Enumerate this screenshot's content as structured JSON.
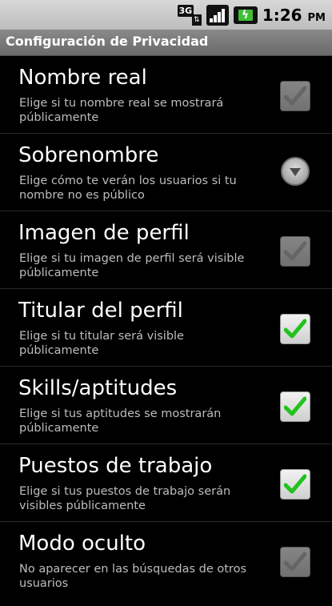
{
  "status_bar": {
    "network": "3G",
    "time": "1:26",
    "ampm": "PM",
    "icons": [
      "3g-icon",
      "signal-icon",
      "battery-icon"
    ]
  },
  "title": "Configuración de Privacidad",
  "settings": [
    {
      "title": "Nombre real",
      "summary": "Elige si tu nombre real se mostrará públicamente",
      "control": "checkbox",
      "checked": true,
      "enabled": false
    },
    {
      "title": "Sobrenombre",
      "summary": "Elige cómo te verán los usuarios si tu nombre no es público",
      "control": "dropdown"
    },
    {
      "title": "Imagen de perfil",
      "summary": "Elige si tu imagen de perfil será visible públicamente",
      "control": "checkbox",
      "checked": true,
      "enabled": false
    },
    {
      "title": "Titular del perfil",
      "summary": "Elige si tu titular será visible públicamente",
      "control": "checkbox",
      "checked": true,
      "enabled": true
    },
    {
      "title": "Skills/aptitudes",
      "summary": "Elige si tus aptitudes se mostrarán públicamente",
      "control": "checkbox",
      "checked": true,
      "enabled": true
    },
    {
      "title": "Puestos de trabajo",
      "summary": "Elige si tus puestos de trabajo serán visibles públicamente",
      "control": "checkbox",
      "checked": true,
      "enabled": true
    },
    {
      "title": "Modo oculto",
      "summary": "No aparecer en las búsquedas de otros usuarios",
      "control": "checkbox",
      "checked": true,
      "enabled": false
    }
  ],
  "colors": {
    "check_active": "#22c21e",
    "check_disabled": "#b8b8b8"
  }
}
